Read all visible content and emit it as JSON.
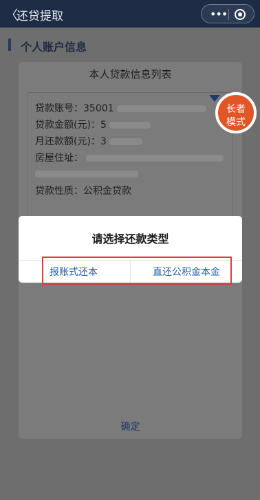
{
  "topbar": {
    "back_symbol": "〈",
    "title": "还贷提取",
    "dots": "•••"
  },
  "background": {
    "section_title": "个人账户信息"
  },
  "loan_dialog": {
    "title": "本人贷款信息列表",
    "rows": [
      {
        "label": "贷款账号：",
        "value": "35001"
      },
      {
        "label": "贷款金额(元)：",
        "value": "5"
      },
      {
        "label": "月还款额(元)：",
        "value": "3"
      },
      {
        "label": "房屋住址：",
        "value": ""
      },
      {
        "label": "贷款性质：",
        "value": "公积金贷款"
      }
    ],
    "confirm": "确定"
  },
  "choice_dialog": {
    "title": "请选择还款类型",
    "option_left": "报账式还本",
    "option_right": "直还公积金本金"
  },
  "elder_badge": {
    "line1": "长者",
    "line2": "模式"
  }
}
